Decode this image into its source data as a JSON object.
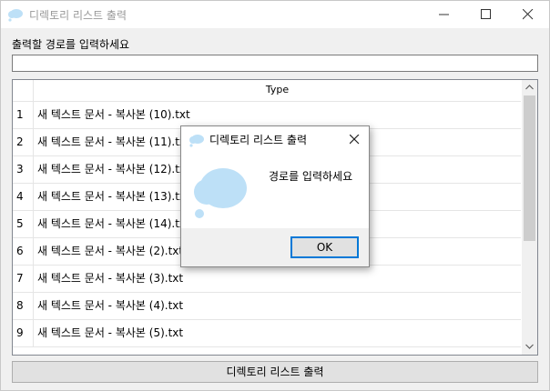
{
  "window": {
    "title": "디렉토리 리스트 출력",
    "icon": "cloud-icon",
    "accent": "#bde0f7"
  },
  "path_label": "출력할 경로를 입력하세요",
  "path_input": {
    "value": ""
  },
  "grid": {
    "column_header": "Type",
    "rows": [
      {
        "index": "1",
        "name": "새 텍스트 문서 - 복사본 (10).txt"
      },
      {
        "index": "2",
        "name": "새 텍스트 문서 - 복사본 (11).txt"
      },
      {
        "index": "3",
        "name": "새 텍스트 문서 - 복사본 (12).txt"
      },
      {
        "index": "4",
        "name": "새 텍스트 문서 - 복사본 (13).txt"
      },
      {
        "index": "5",
        "name": "새 텍스트 문서 - 복사본 (14).txt"
      },
      {
        "index": "6",
        "name": "새 텍스트 문서 - 복사본 (2).txt"
      },
      {
        "index": "7",
        "name": "새 텍스트 문서 - 복사본 (3).txt"
      },
      {
        "index": "8",
        "name": "새 텍스트 문서 - 복사본 (4).txt"
      },
      {
        "index": "9",
        "name": "새 텍스트 문서 - 복사본 (5).txt"
      }
    ]
  },
  "run_button": "디렉토리 리스트 출력",
  "dialog": {
    "title": "디렉토리 리스트 출력",
    "message": "경로를 입력하세요",
    "ok_label": "OK"
  }
}
